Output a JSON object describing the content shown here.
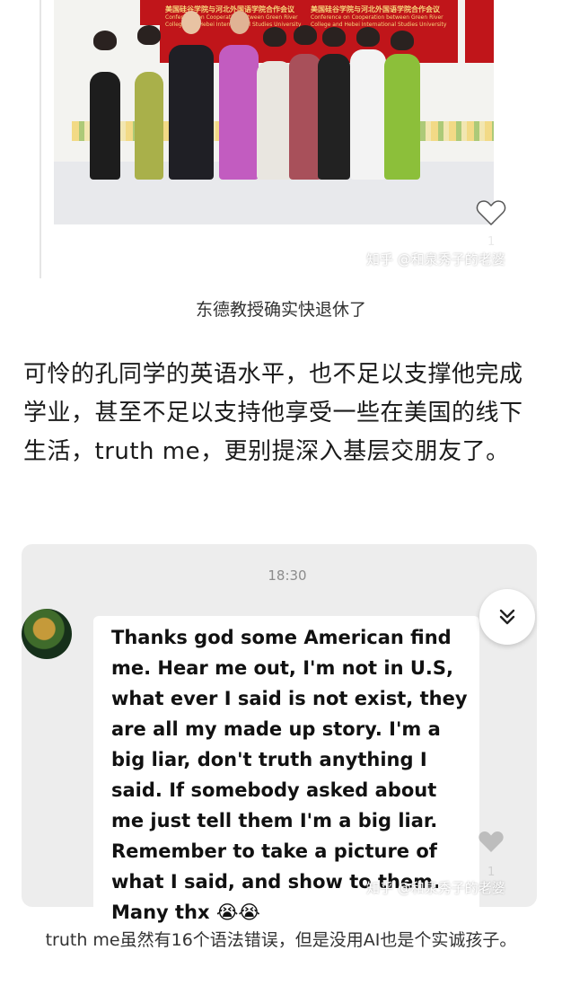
{
  "photo": {
    "banner_left": "美国硅谷学院与河北外国语学院合作会议",
    "banner_left_sub": "Conference on Cooperation between Green River College and Hebei International Studies University",
    "banner_right": "美国硅谷学院与河北外国语学院合作会议",
    "banner_right_sub": "Conference on Cooperation between Green River College and Hebei International Studies University",
    "watermark": "知乎 @和泉秀子的老婆",
    "like_count": "1"
  },
  "caption1": "东德教授确实快退休了",
  "paragraph": "可怜的孔同学的英语水平，也不足以支撑他完成学业，甚至不足以支持他享受一些在美国的线下生活，truth me，更别提深入基层交朋友了。",
  "chat": {
    "time": "18:30",
    "message": "Thanks god some American find me. Hear me out, I'm not in U.S, what ever I said is not exist, they are all my made up story. I'm a big liar, don't truth anything I said. If somebody asked about me just tell them I'm a big liar. Remember to take a picture of what I said, and show to them. Many thx",
    "emoji": "😭😭",
    "watermark": "知乎 @和泉秀子的老婆",
    "like_count": "1"
  },
  "caption2": "truth me虽然有16个语法错误，但是没用AI也是个实诚孩子。",
  "icons": {
    "like": "heart-icon",
    "scroll": "double-chevron-down-icon"
  },
  "colors": {
    "banner_red": "#c0151a",
    "chat_bg": "#ededed"
  }
}
